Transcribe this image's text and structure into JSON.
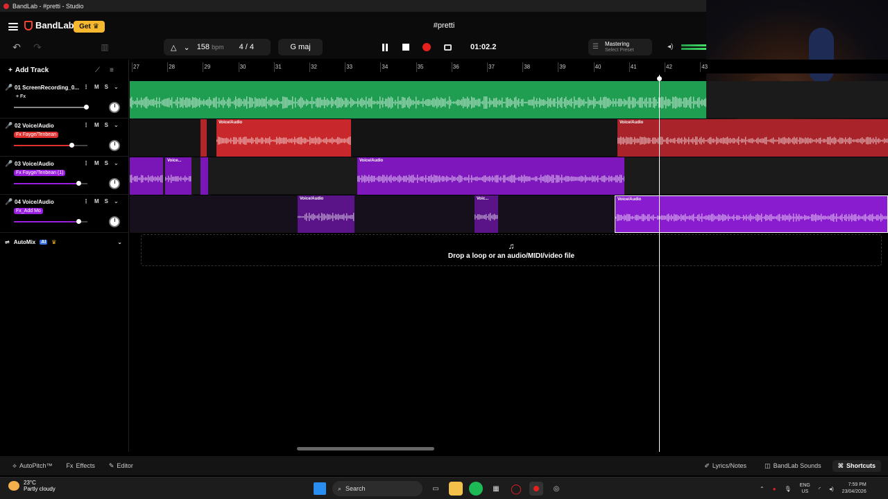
{
  "window": {
    "title": "BandLab - #pretti - Studio"
  },
  "header": {
    "brand": "BandLab",
    "get_label": "Get",
    "project_title": "#pretti",
    "bpm_value": "158",
    "bpm_unit": "bpm",
    "time_signature": "4 / 4",
    "key": "G maj",
    "time_display": "01:02.2",
    "mastering_title": "Mastering",
    "mastering_sub": "Select Preset"
  },
  "sidebar": {
    "add_track_label": "Add Track",
    "automix_label": "AutoMix",
    "ai_badge": "AI"
  },
  "tracks": [
    {
      "name": "01 ScreenRecording_0...",
      "fx": "+ Fx",
      "color": "#22b25a",
      "volume": 0.98
    },
    {
      "name": "02 Voice/Audio",
      "fx": "Fx Fayge/Tenbean",
      "color": "#e0302f",
      "volume": 0.78
    },
    {
      "name": "03 Voice/Audio",
      "fx": "Fx Fayge/Tenbean (1)",
      "color": "#9a1fe0",
      "volume": 0.88
    },
    {
      "name": "04 Voice/Audio",
      "fx": "Fx_Add Mo",
      "color": "#9a1fe0",
      "volume": 0.88
    }
  ],
  "ruler": {
    "bars": [
      "27",
      "28",
      "29",
      "30",
      "31",
      "32",
      "33",
      "34",
      "35",
      "36",
      "37",
      "38",
      "39",
      "40",
      "41",
      "42",
      "43"
    ]
  },
  "clips": {
    "t2": [
      "Voice/Audio",
      "Voice/Audio"
    ],
    "t3": [
      "Voice...",
      "Voice/Audio"
    ],
    "t4": [
      "Voice/Audio",
      "Voic...",
      "Voice/Audio"
    ]
  },
  "dropzone": {
    "text": "Drop a loop or an audio/MIDI/video file"
  },
  "bottom": {
    "autopitch": "AutoPitch™",
    "effects": "Effects",
    "editor": "Editor",
    "lyrics": "Lyrics/Notes",
    "sounds": "BandLab Sounds",
    "shortcuts": "Shortcuts"
  },
  "taskbar": {
    "temp": "23°C",
    "weather": "Partly cloudy",
    "search": "Search",
    "lang1": "ENG",
    "lang2": "US",
    "time": "7:59 PM",
    "date": "23/04/2026"
  },
  "colors": {
    "accent": "#f2442d",
    "green": "#22b25a",
    "red": "#e0302f",
    "purple": "#9a1fe0"
  }
}
